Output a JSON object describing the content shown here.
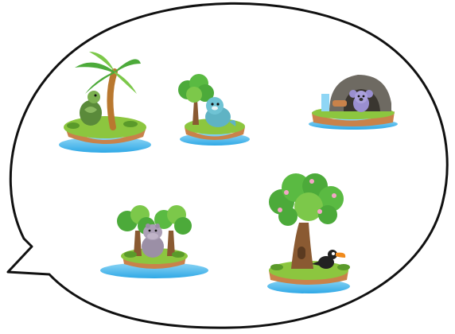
{
  "scene": {
    "type": "speech-bubble-island-map",
    "bubble": {
      "fill": "#ffffff",
      "stroke": "#111111"
    },
    "colors": {
      "water": "#2fa8e6",
      "water_light": "#8fd6f5",
      "grass": "#8cc63f",
      "grass_dark": "#5a9a2a",
      "dirt": "#c9824a",
      "dirt_dark": "#9a5a2e",
      "leaf": "#4caa3a",
      "leaf_light": "#7cc84a",
      "trunk": "#8a5a32",
      "palm_trunk": "#b9782f",
      "rock": "#6e6a62",
      "rock_dark": "#4a4640"
    },
    "islands": [
      {
        "name": "palm-island",
        "animal": "turtle-icon",
        "animal_color": "#5a8a3a"
      },
      {
        "name": "tree-island",
        "animal": "seal-icon",
        "animal_color": "#5fb3c4"
      },
      {
        "name": "cave-island",
        "animal": "koala-icon",
        "animal_color": "#9a8fd0"
      },
      {
        "name": "forest-island",
        "animal": "hippo-icon",
        "animal_color": "#9b8fa6"
      },
      {
        "name": "big-tree-island",
        "animal": "toucan-icon",
        "animal_color": "#222222",
        "beak_color": "#f08a1c"
      }
    ]
  }
}
